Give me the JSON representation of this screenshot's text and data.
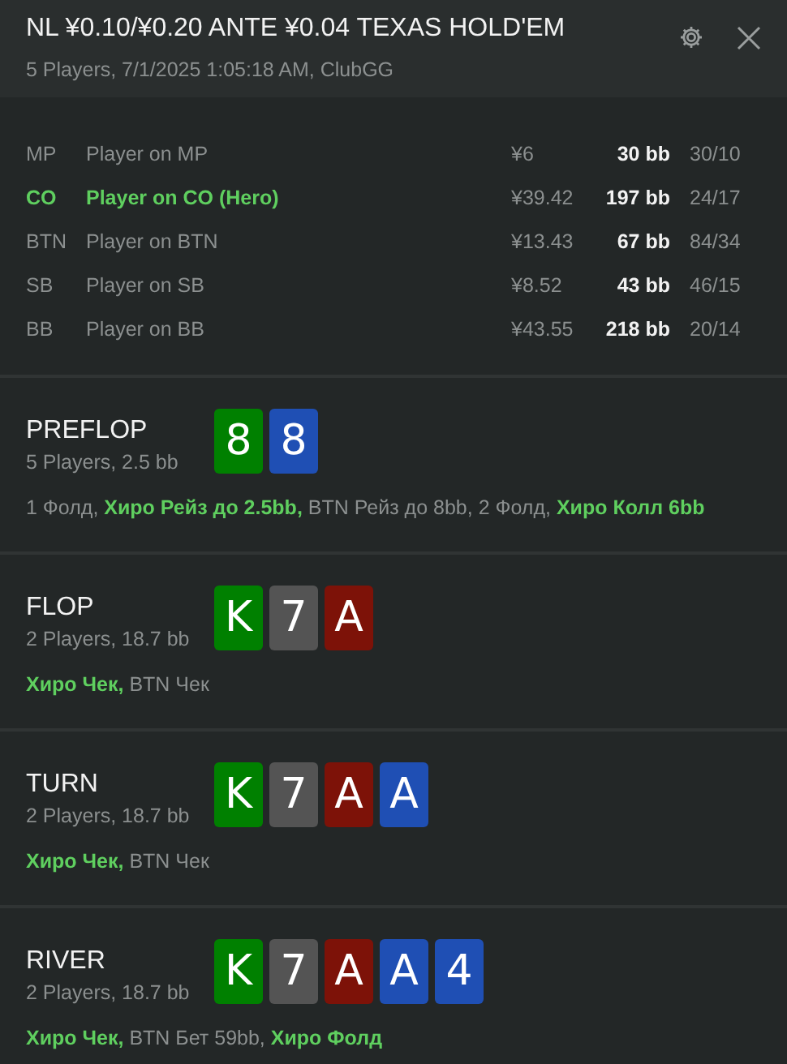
{
  "header": {
    "title": "NL ¥0.10/¥0.20 ANTE ¥0.04 TEXAS HOLD'EM",
    "subtitle": "5 Players, 7/1/2025 1:05:18 AM, ClubGG"
  },
  "players": [
    {
      "position": "MP",
      "name": "Player on MP",
      "stack": "¥6",
      "bb": "30 bb",
      "stats": "30/10",
      "hero": false
    },
    {
      "position": "CO",
      "name": "Player on CO (Hero)",
      "stack": "¥39.42",
      "bb": "197 bb",
      "stats": "24/17",
      "hero": true
    },
    {
      "position": "BTN",
      "name": "Player on BTN",
      "stack": "¥13.43",
      "bb": "67 bb",
      "stats": "84/34",
      "hero": false
    },
    {
      "position": "SB",
      "name": "Player on SB",
      "stack": "¥8.52",
      "bb": "43 bb",
      "stats": "46/15",
      "hero": false
    },
    {
      "position": "BB",
      "name": "Player on BB",
      "stack": "¥43.55",
      "bb": "218 bb",
      "stats": "20/14",
      "hero": false
    }
  ],
  "streets": [
    {
      "name": "PREFLOP",
      "info": "5 Players, 2.5 bb",
      "cards": [
        {
          "rank": "8",
          "color": "#008000"
        },
        {
          "rank": "8",
          "color": "#1f4fb4"
        }
      ],
      "actions": "1 Фолд, **Хиро Рейз до 2.5bb,** BTN Рейз до 8bb, 2 Фолд, **Хиро Колл 6bb**"
    },
    {
      "name": "FLOP",
      "info": "2 Players, 18.7 bb",
      "cards": [
        {
          "rank": "K",
          "color": "#008000"
        },
        {
          "rank": "7",
          "color": "#545454"
        },
        {
          "rank": "A",
          "color": "#7d1208"
        }
      ],
      "actions": "**Хиро Чек,** BTN Чек"
    },
    {
      "name": "TURN",
      "info": "2 Players, 18.7 bb",
      "cards": [
        {
          "rank": "K",
          "color": "#008000"
        },
        {
          "rank": "7",
          "color": "#545454"
        },
        {
          "rank": "A",
          "color": "#7d1208"
        },
        {
          "rank": "A",
          "color": "#1f4fb4"
        }
      ],
      "actions": "**Хиро Чек,** BTN Чек"
    },
    {
      "name": "RIVER",
      "info": "2 Players, 18.7 bb",
      "cards": [
        {
          "rank": "K",
          "color": "#008000"
        },
        {
          "rank": "7",
          "color": "#545454"
        },
        {
          "rank": "A",
          "color": "#7d1208"
        },
        {
          "rank": "A",
          "color": "#1f4fb4"
        },
        {
          "rank": "4",
          "color": "#1f4fb4"
        }
      ],
      "actions": "**Хиро Чек,** BTN Бет 59bb, **Хиро Фолд**"
    }
  ]
}
